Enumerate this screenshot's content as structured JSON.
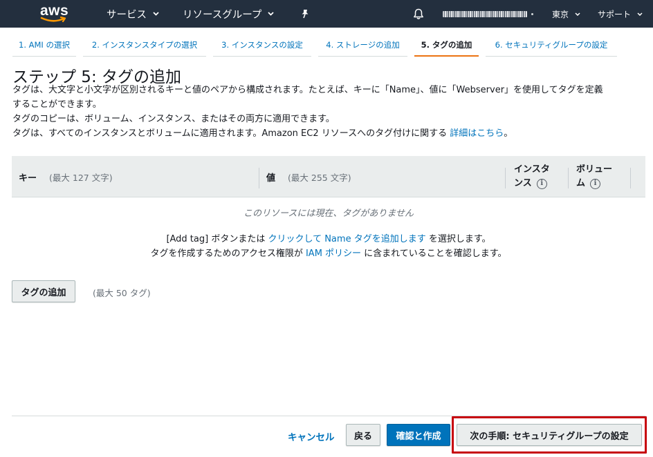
{
  "topnav": {
    "logo_text": "aws",
    "services_label": "サービス",
    "resource_groups_label": "リソースグループ",
    "region_label": "東京",
    "support_label": "サポート"
  },
  "wizard_tabs": [
    {
      "label": "1. AMI の選択"
    },
    {
      "label": "2. インスタンスタイプの選択"
    },
    {
      "label": "3. インスタンスの設定"
    },
    {
      "label": "4. ストレージの追加"
    },
    {
      "label": "5. タグの追加",
      "active": true
    },
    {
      "label": "6. セキュリティグループの設定"
    }
  ],
  "page": {
    "title": "ステップ 5: タグの追加",
    "desc_line1": "タグは、大文字と小文字が区別されるキーと値のペアから構成されます。たとえば、キーに「Name」、値に「Webserver」を使用してタグを定義",
    "desc_line2": "することができます。",
    "desc_line3": "タグのコピーは、ボリューム、インスタンス、またはその両方に適用できます。",
    "desc_line4_prefix": "タグは、すべてのインスタンスとボリュームに適用されます。Amazon EC2 リソースへのタグ付けに関する ",
    "desc_line4_link": "詳細はこちら",
    "desc_line4_suffix": "。"
  },
  "table": {
    "key_header": "キー",
    "key_hint": "(最大 127 文字)",
    "value_header": "値",
    "value_hint": "(最大 255 文字)",
    "instances_header_1": "インスタ",
    "instances_header_2": "ンス",
    "volumes_header_1": "ボリュー",
    "volumes_header_2": "ム",
    "info_glyph": "i",
    "empty_message": "このリソースには現在、タグがありません"
  },
  "help": {
    "line1_prefix": "[Add tag] ボタンまたは ",
    "line1_link": "クリックして Name タグを追加します",
    "line1_suffix": " を選択します。",
    "line2_prefix": "タグを作成するためのアクセス権限が ",
    "line2_link": "IAM ポリシー",
    "line2_suffix": " に含まれていることを確認します。"
  },
  "add_tag": {
    "button_label": "タグの追加",
    "max_label": "(最大 50 タグ)"
  },
  "footer": {
    "cancel_label": "キャンセル",
    "back_label": "戻る",
    "review_launch_label": "確認と作成",
    "next_label": "次の手順: セキュリティグループの設定"
  },
  "colors": {
    "nav_bg": "#232f3e",
    "link": "#0073bb",
    "active_tab_underline": "#ec7211",
    "primary_button": "#0073bb",
    "highlight_box": "#c7000b"
  }
}
